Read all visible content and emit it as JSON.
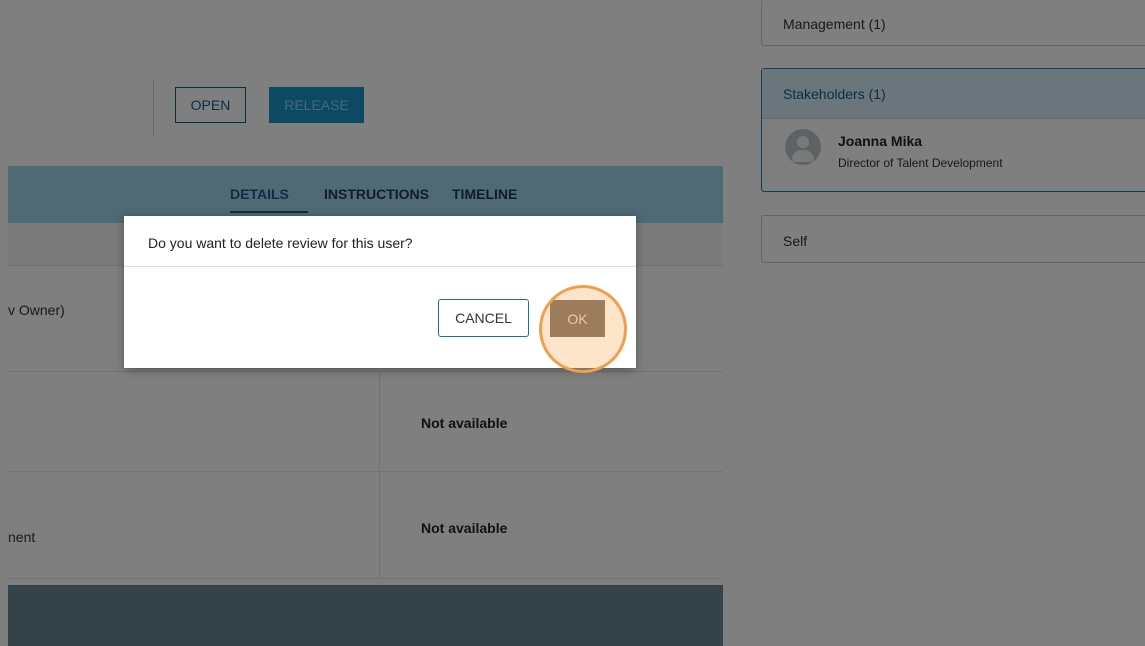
{
  "toolbar": {
    "open_label": "OPEN",
    "release_label": "RELEASE"
  },
  "tabs": [
    {
      "label": "DETAILS",
      "active": true
    },
    {
      "label": "INSTRUCTIONS",
      "active": false
    },
    {
      "label": "TIMELINE",
      "active": false
    }
  ],
  "table": {
    "rows": [
      {
        "left": "v Owner)",
        "right": ""
      },
      {
        "left": "",
        "right": "Not available"
      },
      {
        "left": "nent",
        "right": "Not available"
      }
    ]
  },
  "side": {
    "management_title": "Management (1)",
    "stakeholders_title": "Stakeholders (1)",
    "stakeholder": {
      "name": "Joanna Mika",
      "role": "Director of Talent Development"
    },
    "self_title": "Self"
  },
  "dialog": {
    "message": "Do you want to delete review for this user?",
    "cancel_label": "CANCEL",
    "ok_label": "OK"
  },
  "colors": {
    "accent": "#1795c4",
    "primary_dark": "#0f5f84",
    "tab_bar": "#9fd3ea",
    "click_highlight": "#f0a04d"
  }
}
